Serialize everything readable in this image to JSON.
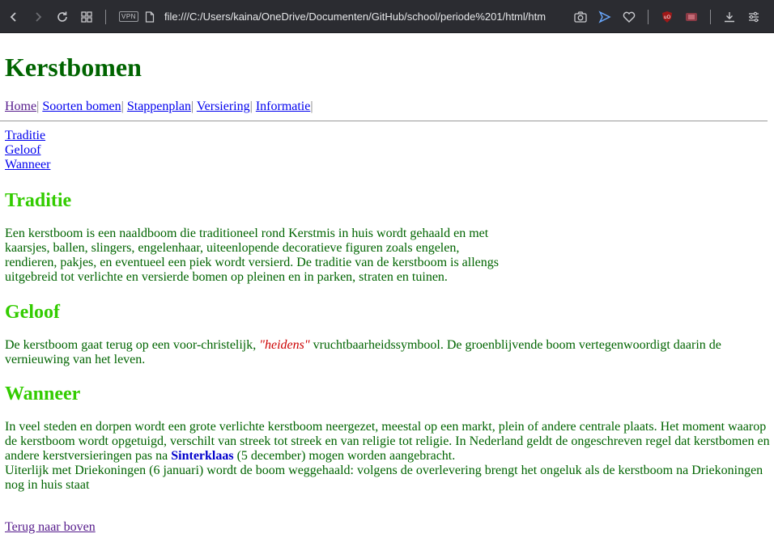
{
  "browser": {
    "url": "file:///C:/Users/kaina/OneDrive/Documenten/GitHub/school/periode%201/html/htm",
    "vpn_label": "VPN"
  },
  "page": {
    "title": "Kerstbomen",
    "nav": [
      {
        "label": "Home",
        "sep": "|"
      },
      {
        "label": "Soorten bomen",
        "sep": "|"
      },
      {
        "label": "Stappenplan",
        "sep": "|"
      },
      {
        "label": "Versiering",
        "sep": "|"
      },
      {
        "label": "Informatie",
        "sep": "|"
      }
    ],
    "toc": [
      "Traditie",
      "Geloof",
      "Wanneer"
    ],
    "sections": {
      "traditie": {
        "heading": "Traditie",
        "text": "Een kerstboom is een naaldboom die traditioneel rond Kerstmis in huis wordt gehaald en met kaarsjes, ballen, slingers, engelenhaar, uiteenlopende decoratieve figuren zoals engelen, rendieren, pakjes, en eventueel een piek wordt versierd. De traditie van de kerstboom is allengs uitgebreid tot verlichte en versierde bomen op pleinen en in parken, straten en tuinen."
      },
      "geloof": {
        "heading": "Geloof",
        "text_before": "De kerstboom gaat terug op een voor-christelijk,",
        "emphasis": "\"heidens\"",
        "text_after": "vruchtbaarheidssymbool. De groenblijvende boom vertegenwoordigt daarin de vernieuwing van het leven."
      },
      "wanneer": {
        "heading": "Wanneer",
        "text_before": "In veel steden en dorpen wordt een grote verlichte kerstboom neergezet, meestal op een markt, plein of andere centrale plaats. Het moment waarop de kerstboom wordt opgetuigd, verschilt van streek tot streek en van religie tot religie. In Nederland geldt de ongeschreven regel dat kerstbomen en andere kerstversieringen pas na",
        "bold": "Sinterklaas",
        "text_after": "(5 december) mogen worden aangebracht.",
        "text_line2": "Uiterlijk met Driekoningen (6 januari) wordt de boom weggehaald: volgens de overlevering brengt het ongeluk als de kerstboom na Driekoningen nog in huis staat"
      }
    },
    "back_to_top": "Terug naar boven"
  }
}
